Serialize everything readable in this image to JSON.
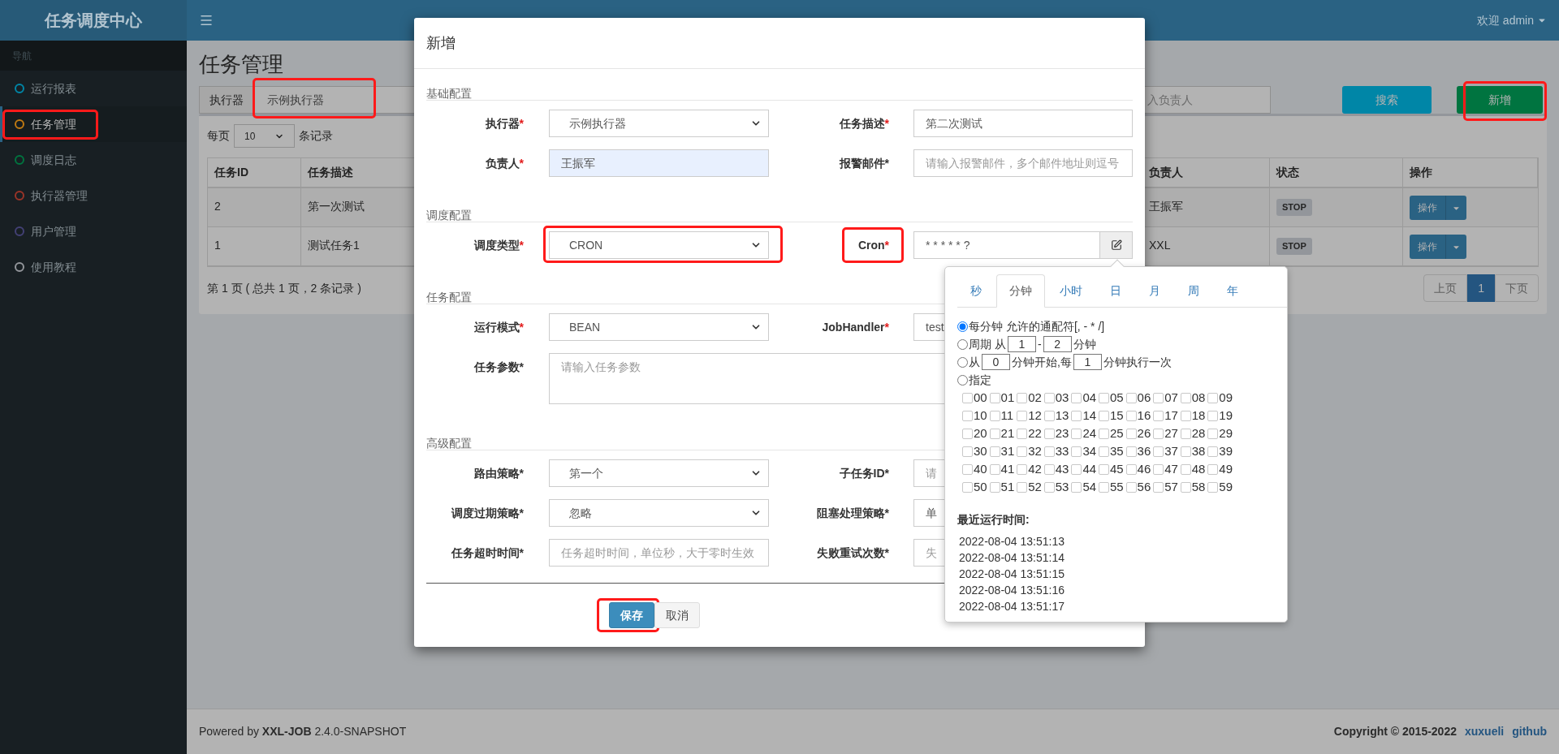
{
  "header": {
    "logo": "任务调度中心",
    "user": "欢迎 admin"
  },
  "sidebar": {
    "heading": "导航",
    "items": [
      {
        "label": "运行报表",
        "color": "#0086a7",
        "selected": false,
        "highlighted": false
      },
      {
        "label": "任务管理",
        "color": "#c07a12",
        "selected": true,
        "highlighted": true
      },
      {
        "label": "调度日志",
        "color": "#00743f",
        "selected": false,
        "highlighted": false
      },
      {
        "label": "执行器管理",
        "color": "#9b3428",
        "selected": false,
        "highlighted": false
      },
      {
        "label": "用户管理",
        "color": "#434075",
        "selected": false,
        "highlighted": false
      },
      {
        "label": "使用教程",
        "color": "#93969b",
        "selected": false,
        "highlighted": false
      }
    ]
  },
  "page": {
    "title": "任务管理",
    "filter": {
      "executor_label": "执行器",
      "executor_value": "示例执行器",
      "executor_highlighted": true,
      "owner_placeholder": "入负责人",
      "search_button": "搜索",
      "add_button": "新增",
      "add_highlighted": true
    },
    "page_size": {
      "prefix": "每页",
      "value": "10",
      "suffix": "条记录"
    },
    "table": {
      "columns": [
        "任务ID",
        "任务描述",
        "负责人",
        "状态",
        "操作"
      ],
      "rows": [
        {
          "cells": [
            "2",
            "第一次测试",
            "王振军"
          ],
          "status": "STOP",
          "action": "操作"
        },
        {
          "cells": [
            "1",
            "测试任务1",
            "XXL"
          ],
          "status": "STOP",
          "action": "操作"
        }
      ]
    },
    "summary": "第 1 页 ( 总共 1 页，2 条记录 )",
    "pager": [
      {
        "label": "上页",
        "selected": false
      },
      {
        "label": "1",
        "selected": true
      },
      {
        "label": "下页",
        "selected": false
      }
    ]
  },
  "modal": {
    "title": "新增",
    "sections": [
      {
        "title": "基础配置",
        "rows": [
          {
            "fields": [
              {
                "label": "执行器",
                "mark": "*",
                "mark_red": true,
                "kind": "select",
                "value": "示例执行器",
                "autofilled": false,
                "label_highlighted": false,
                "field_highlighted": false
              },
              {
                "label": "任务描述",
                "mark": "*",
                "mark_red": true,
                "kind": "input",
                "value": "第二次测试",
                "autofilled": false,
                "label_highlighted": false,
                "field_highlighted": false
              }
            ]
          },
          {
            "fields": [
              {
                "label": "负责人",
                "mark": "*",
                "mark_red": true,
                "kind": "input",
                "value": "王振军",
                "autofilled": true,
                "label_highlighted": false,
                "field_highlighted": false
              },
              {
                "label": "报警邮件",
                "mark": "*",
                "mark_red": false,
                "kind": "placeholder",
                "placeholder": "请输入报警邮件，多个邮件地址则逗号",
                "autofilled": false,
                "label_highlighted": false,
                "field_highlighted": false
              }
            ]
          }
        ]
      },
      {
        "title": "调度配置",
        "rows": [
          {
            "fields": [
              {
                "label": "调度类型",
                "mark": "*",
                "mark_red": true,
                "kind": "select",
                "value": "CRON",
                "autofilled": false,
                "label_highlighted": false,
                "field_highlighted": true
              },
              {
                "label": "Cron",
                "mark": "*",
                "mark_red": true,
                "kind": "cron",
                "value": "* * * * * ?",
                "autofilled": false,
                "label_highlighted": true,
                "field_highlighted": false
              }
            ]
          }
        ]
      },
      {
        "title": "任务配置",
        "rows": [
          {
            "fields": [
              {
                "label": "运行模式",
                "mark": "*",
                "mark_red": true,
                "kind": "select",
                "value": "BEAN",
                "autofilled": false,
                "label_highlighted": false,
                "field_highlighted": false
              },
              {
                "label": "JobHandler",
                "mark": "*",
                "mark_red": true,
                "kind": "input",
                "value": "test",
                "autofilled": false,
                "label_highlighted": false,
                "field_highlighted": false
              }
            ]
          },
          {
            "fields": [
              {
                "label": "任务参数",
                "mark": "*",
                "mark_red": false,
                "kind": "textarea",
                "placeholder": "请输入任务参数",
                "autofilled": false,
                "label_highlighted": false,
                "field_highlighted": false
              }
            ]
          }
        ]
      },
      {
        "title": "高级配置",
        "rows": [
          {
            "fields": [
              {
                "label": "路由策略",
                "mark": "*",
                "mark_red": false,
                "kind": "select",
                "value": "第一个",
                "autofilled": false,
                "label_highlighted": false,
                "field_highlighted": false
              },
              {
                "label": "子任务ID",
                "mark": "*",
                "mark_red": false,
                "kind": "placeholder",
                "placeholder": "请",
                "autofilled": false,
                "label_highlighted": false,
                "field_highlighted": false
              }
            ]
          },
          {
            "fields": [
              {
                "label": "调度过期策略",
                "mark": "*",
                "mark_red": false,
                "kind": "select",
                "value": "忽略",
                "autofilled": false,
                "label_highlighted": false,
                "field_highlighted": false
              },
              {
                "label": "阻塞处理策略",
                "mark": "*",
                "mark_red": false,
                "kind": "input",
                "value": "单",
                "autofilled": false,
                "label_highlighted": false,
                "field_highlighted": false
              }
            ]
          },
          {
            "fields": [
              {
                "label": "任务超时时间",
                "mark": "*",
                "mark_red": false,
                "kind": "placeholder",
                "placeholder": "任务超时时间，单位秒，大于零时生效",
                "autofilled": false,
                "label_highlighted": false,
                "field_highlighted": false
              },
              {
                "label": "失败重试次数",
                "mark": "*",
                "mark_red": false,
                "kind": "placeholder",
                "placeholder": "失",
                "autofilled": false,
                "label_highlighted": false,
                "field_highlighted": false
              }
            ]
          }
        ]
      }
    ],
    "buttons": [
      {
        "label": "保存",
        "kind": "primary",
        "highlighted": true
      },
      {
        "label": "取消",
        "kind": "default",
        "highlighted": false
      }
    ]
  },
  "cron_popup": {
    "tabs": [
      {
        "label": "秒",
        "selected": false
      },
      {
        "label": "分钟",
        "selected": true
      },
      {
        "label": "小时",
        "selected": false
      },
      {
        "label": "日",
        "selected": false
      },
      {
        "label": "月",
        "selected": false
      },
      {
        "label": "周",
        "selected": false
      },
      {
        "label": "年",
        "selected": false
      }
    ],
    "options": [
      {
        "checked": true,
        "parts": [
          {
            "kind": "text",
            "text": "每分钟 允许的通配符[, - * /]"
          }
        ]
      },
      {
        "checked": false,
        "parts": [
          {
            "kind": "text",
            "text": "周期 从"
          },
          {
            "kind": "input",
            "value": "1"
          },
          {
            "kind": "text",
            "text": "-"
          },
          {
            "kind": "input",
            "value": "2"
          },
          {
            "kind": "text",
            "text": "分钟"
          }
        ]
      },
      {
        "checked": false,
        "parts": [
          {
            "kind": "text",
            "text": "从"
          },
          {
            "kind": "input",
            "value": "0"
          },
          {
            "kind": "text",
            "text": "分钟开始,每"
          },
          {
            "kind": "input",
            "value": "1"
          },
          {
            "kind": "text",
            "text": "分钟执行一次"
          }
        ]
      },
      {
        "checked": false,
        "parts": [
          {
            "kind": "text",
            "text": "指定"
          }
        ]
      }
    ],
    "minutes": [
      {
        "label": "00",
        "checked": false
      },
      {
        "label": "01",
        "checked": false
      },
      {
        "label": "02",
        "checked": false
      },
      {
        "label": "03",
        "checked": false
      },
      {
        "label": "04",
        "checked": false
      },
      {
        "label": "05",
        "checked": false
      },
      {
        "label": "06",
        "checked": false
      },
      {
        "label": "07",
        "checked": false
      },
      {
        "label": "08",
        "checked": false
      },
      {
        "label": "09",
        "checked": false
      },
      {
        "label": "10",
        "checked": false
      },
      {
        "label": "11",
        "checked": false
      },
      {
        "label": "12",
        "checked": false
      },
      {
        "label": "13",
        "checked": false
      },
      {
        "label": "14",
        "checked": false
      },
      {
        "label": "15",
        "checked": false
      },
      {
        "label": "16",
        "checked": false
      },
      {
        "label": "17",
        "checked": false
      },
      {
        "label": "18",
        "checked": false
      },
      {
        "label": "19",
        "checked": false
      },
      {
        "label": "20",
        "checked": false
      },
      {
        "label": "21",
        "checked": false
      },
      {
        "label": "22",
        "checked": false
      },
      {
        "label": "23",
        "checked": false
      },
      {
        "label": "24",
        "checked": false
      },
      {
        "label": "25",
        "checked": false
      },
      {
        "label": "26",
        "checked": false
      },
      {
        "label": "27",
        "checked": false
      },
      {
        "label": "28",
        "checked": false
      },
      {
        "label": "29",
        "checked": false
      },
      {
        "label": "30",
        "checked": false
      },
      {
        "label": "31",
        "checked": false
      },
      {
        "label": "32",
        "checked": false
      },
      {
        "label": "33",
        "checked": false
      },
      {
        "label": "34",
        "checked": false
      },
      {
        "label": "35",
        "checked": false
      },
      {
        "label": "36",
        "checked": false
      },
      {
        "label": "37",
        "checked": false
      },
      {
        "label": "38",
        "checked": false
      },
      {
        "label": "39",
        "checked": false
      },
      {
        "label": "40",
        "checked": false
      },
      {
        "label": "41",
        "checked": false
      },
      {
        "label": "42",
        "checked": false
      },
      {
        "label": "43",
        "checked": false
      },
      {
        "label": "44",
        "checked": false
      },
      {
        "label": "45",
        "checked": false
      },
      {
        "label": "46",
        "checked": false
      },
      {
        "label": "47",
        "checked": false
      },
      {
        "label": "48",
        "checked": false
      },
      {
        "label": "49",
        "checked": false
      },
      {
        "label": "50",
        "checked": false
      },
      {
        "label": "51",
        "checked": false
      },
      {
        "label": "52",
        "checked": false
      },
      {
        "label": "53",
        "checked": false
      },
      {
        "label": "54",
        "checked": false
      },
      {
        "label": "55",
        "checked": false
      },
      {
        "label": "56",
        "checked": false
      },
      {
        "label": "57",
        "checked": false
      },
      {
        "label": "58",
        "checked": false
      },
      {
        "label": "59",
        "checked": false
      }
    ],
    "recent_title": "最近运行时间:",
    "recent_times": [
      "2022-08-04 13:51:13",
      "2022-08-04 13:51:14",
      "2022-08-04 13:51:15",
      "2022-08-04 13:51:16",
      "2022-08-04 13:51:17"
    ]
  },
  "footer": {
    "powered": "Powered by **XXL-JOB** 2.4.0-SNAPSHOT",
    "copyright": "Copyright © 2015-2022",
    "links": [
      "xuxueli",
      "github"
    ]
  }
}
